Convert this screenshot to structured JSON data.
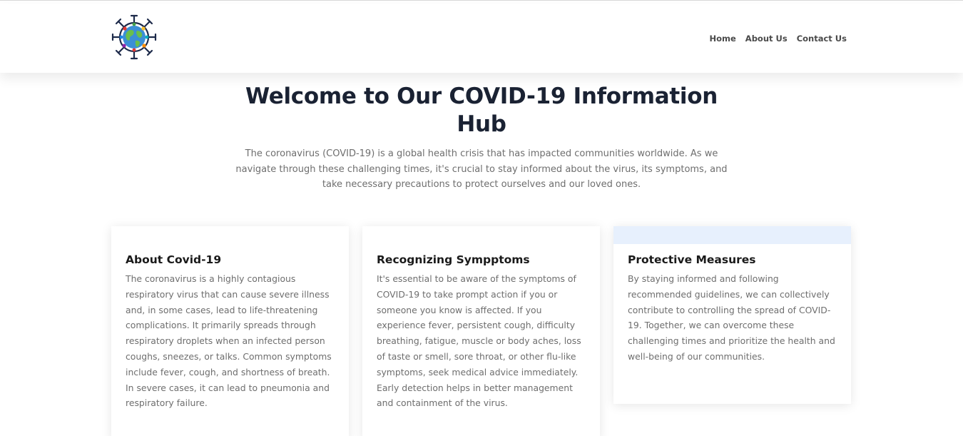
{
  "header": {
    "logo_icon": "covid-virus-globe-icon",
    "nav": [
      {
        "label": "Home"
      },
      {
        "label": "About Us"
      },
      {
        "label": "Contact Us"
      }
    ]
  },
  "hero": {
    "title": "Welcome to Our COVID-19 Information Hub",
    "text": "The coronavirus (COVID-19) is a global health crisis that has impacted communities worldwide. As we navigate through these challenging times, it's crucial to stay informed about the virus, its symptoms, and take necessary precautions to protect ourselves and our loved ones."
  },
  "cards": [
    {
      "title": "About Covid-19",
      "text": "The coronavirus is a highly contagious respiratory virus that can cause severe illness and, in some cases, lead to life-threatening complications. It primarily spreads through respiratory droplets when an infected person coughs, sneezes, or talks. Common symptoms include fever, cough, and shortness of breath. In severe cases, it can lead to pneumonia and respiratory failure."
    },
    {
      "title": "Recognizing Sympptoms",
      "text": "It's essential to be aware of the symptoms of COVID-19 to take prompt action if you or someone you know is affected. If you experience fever, persistent cough, difficulty breathing, fatigue, muscle or body aches, loss of taste or smell, sore throat, or other flu-like symptoms, seek medical advice immediately. Early detection helps in better management and containment of the virus."
    },
    {
      "title": "Protective Measures",
      "text": "By staying informed and following recommended guidelines, we can collectively contribute to controlling the spread of COVID-19. Together, we can overcome these challenging times and prioritize the health and well-being of our communities."
    }
  ],
  "colors": {
    "heading": "#1a2233",
    "body_text": "#6e6e6e",
    "nav_text": "#4a4a4a",
    "card_highlight": "#e7f0fd"
  }
}
